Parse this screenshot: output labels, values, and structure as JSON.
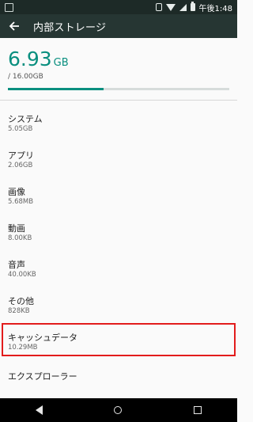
{
  "status_bar": {
    "time": "午後1:48"
  },
  "app_bar": {
    "title": "内部ストレージ"
  },
  "summary": {
    "used_value": "6.93",
    "used_unit": "GB",
    "total": "/ 16.00GB",
    "used_fraction": 0.433
  },
  "items": [
    {
      "title": "システム",
      "size": "5.05GB"
    },
    {
      "title": "アプリ",
      "size": "2.06GB"
    },
    {
      "title": "画像",
      "size": "5.68MB"
    },
    {
      "title": "動画",
      "size": "8.00KB"
    },
    {
      "title": "音声",
      "size": "40.00KB"
    },
    {
      "title": "その他",
      "size": "828KB"
    },
    {
      "title": "キャッシュデータ",
      "size": "10.29MB"
    },
    {
      "title": "エクスプローラー",
      "size": ""
    }
  ],
  "colors": {
    "accent": "#0a8f7f",
    "highlight": "#e21c1c",
    "app_bar": "#263633"
  }
}
